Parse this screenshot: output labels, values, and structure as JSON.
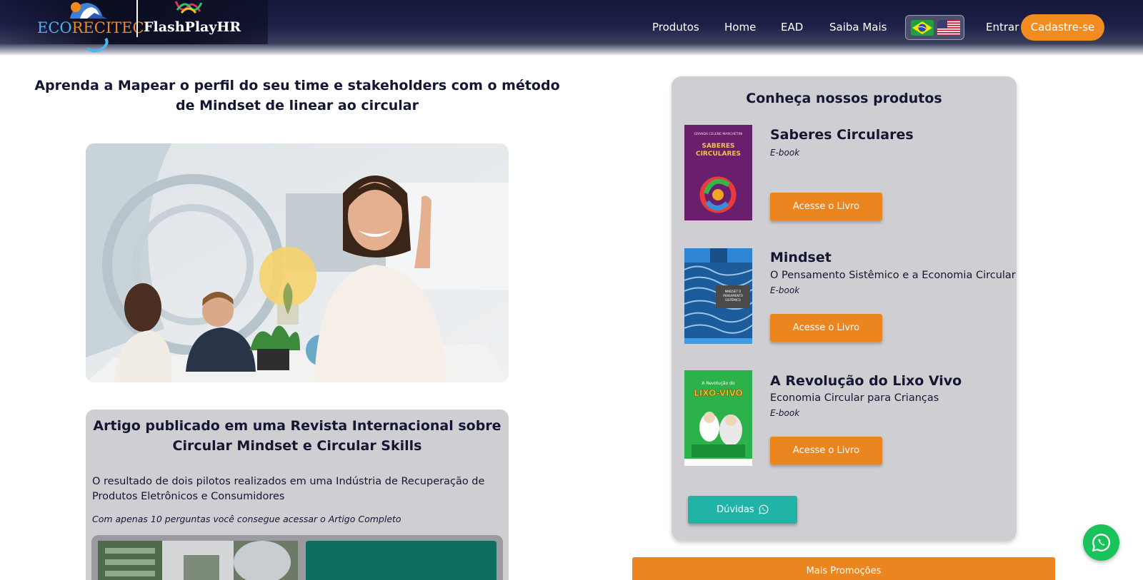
{
  "header": {
    "logo_eco_part1": "ECO",
    "logo_eco_part2": "RECITEC",
    "logo_flashplay": "FlashPlayHR",
    "nav": [
      {
        "label": "Produtos"
      },
      {
        "label": "Home"
      },
      {
        "label": "EAD"
      },
      {
        "label": "Saiba Mais"
      }
    ],
    "flags": [
      "brazil-flag-icon",
      "usa-flag-icon"
    ],
    "login_label": "Entrar",
    "signup_label": "Cadastre-se"
  },
  "main": {
    "title": "Aprenda a Mapear o perfil do seu time e stakeholders com o método de Mindset de linear ao circular",
    "article": {
      "title": "Artigo publicado em uma Revista Internacional sobre Circular Mindset e Circular Skills",
      "description": "O resultado de dois pilotos realizados em uma Indústria de Recuperação de Produtos Eletrônicos e Consumidores",
      "note": "Com apenas 10 perguntas você consegue acessar o Artigo Completo"
    }
  },
  "products": {
    "heading": "Conheça nossos produtos",
    "items": [
      {
        "name": "Saberes Circulares",
        "subtitle": "",
        "type": "E-book",
        "button": "Acesse o Livro",
        "cover_author": "GRANDA CELENE MARCHETINI",
        "cover_title": "SABERES CIRCULARES"
      },
      {
        "name": "Mindset",
        "subtitle": "O Pensamento Sistêmico e a Economia Circular",
        "type": "E-book",
        "button": "Acesse o Livro",
        "cover_title": "MINDSET: O PENSAMENTO SISTÊMICO E A ECONOMIA CIRCULAR"
      },
      {
        "name": "A Revolução do Lixo Vivo",
        "subtitle": "Economia Circular para Crianças",
        "type": "E-book",
        "button": "Acesse o Livro",
        "cover_title_1": "A Revolução do",
        "cover_title_2": "LIXO-VIVO"
      }
    ],
    "help_button": "Dúvidas",
    "promo_button": "Mais Promoções"
  },
  "colors": {
    "header_bg": "#1c2048",
    "accent_orange": "#ea851f",
    "teal": "#21b3a6",
    "card_gray": "#cfcfd3",
    "text_dark": "#141632",
    "whatsapp_green": "#19c25a"
  },
  "icons": {
    "whatsapp": "whatsapp-icon"
  }
}
